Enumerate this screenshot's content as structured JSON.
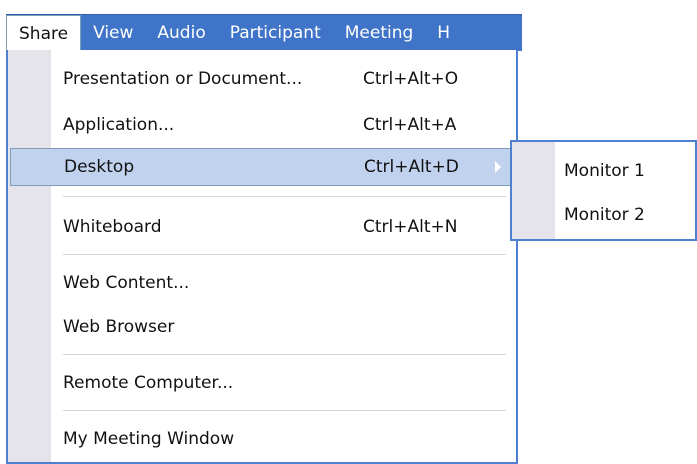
{
  "menubar": {
    "items": [
      {
        "label": "Share"
      },
      {
        "label": "View"
      },
      {
        "label": "Audio"
      },
      {
        "label": "Participant"
      },
      {
        "label": "Meeting"
      },
      {
        "label": "H"
      }
    ]
  },
  "share_menu": {
    "items": [
      {
        "label": "Presentation or Document...",
        "shortcut": "Ctrl+Alt+O"
      },
      {
        "label": "Application...",
        "shortcut": "Ctrl+Alt+A"
      },
      {
        "label": "Desktop",
        "shortcut": "Ctrl+Alt+D"
      },
      {
        "label": "Whiteboard",
        "shortcut": "Ctrl+Alt+N"
      },
      {
        "label": "Web Content...",
        "shortcut": ""
      },
      {
        "label": "Web Browser",
        "shortcut": ""
      },
      {
        "label": "Remote Computer...",
        "shortcut": ""
      },
      {
        "label": "My Meeting Window",
        "shortcut": ""
      }
    ]
  },
  "desktop_submenu": {
    "items": [
      {
        "label": "Monitor 1"
      },
      {
        "label": "Monitor 2"
      }
    ]
  },
  "colors": {
    "menubar_bg": "#3f74c8",
    "selection_bg": "#c1d2ee",
    "gutter": "#e4e4ea",
    "border": "#4f7fd0"
  }
}
